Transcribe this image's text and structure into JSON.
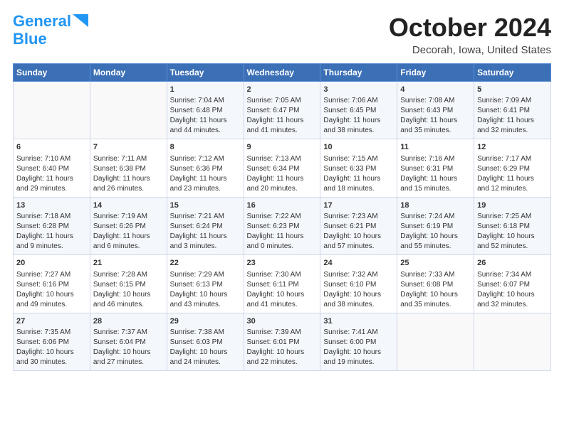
{
  "header": {
    "logo_line1": "General",
    "logo_line2": "Blue",
    "month_title": "October 2024",
    "location": "Decorah, Iowa, United States"
  },
  "weekdays": [
    "Sunday",
    "Monday",
    "Tuesday",
    "Wednesday",
    "Thursday",
    "Friday",
    "Saturday"
  ],
  "weeks": [
    [
      {
        "day": "",
        "info": ""
      },
      {
        "day": "",
        "info": ""
      },
      {
        "day": "1",
        "info": "Sunrise: 7:04 AM\nSunset: 6:48 PM\nDaylight: 11 hours and 44 minutes."
      },
      {
        "day": "2",
        "info": "Sunrise: 7:05 AM\nSunset: 6:47 PM\nDaylight: 11 hours and 41 minutes."
      },
      {
        "day": "3",
        "info": "Sunrise: 7:06 AM\nSunset: 6:45 PM\nDaylight: 11 hours and 38 minutes."
      },
      {
        "day": "4",
        "info": "Sunrise: 7:08 AM\nSunset: 6:43 PM\nDaylight: 11 hours and 35 minutes."
      },
      {
        "day": "5",
        "info": "Sunrise: 7:09 AM\nSunset: 6:41 PM\nDaylight: 11 hours and 32 minutes."
      }
    ],
    [
      {
        "day": "6",
        "info": "Sunrise: 7:10 AM\nSunset: 6:40 PM\nDaylight: 11 hours and 29 minutes."
      },
      {
        "day": "7",
        "info": "Sunrise: 7:11 AM\nSunset: 6:38 PM\nDaylight: 11 hours and 26 minutes."
      },
      {
        "day": "8",
        "info": "Sunrise: 7:12 AM\nSunset: 6:36 PM\nDaylight: 11 hours and 23 minutes."
      },
      {
        "day": "9",
        "info": "Sunrise: 7:13 AM\nSunset: 6:34 PM\nDaylight: 11 hours and 20 minutes."
      },
      {
        "day": "10",
        "info": "Sunrise: 7:15 AM\nSunset: 6:33 PM\nDaylight: 11 hours and 18 minutes."
      },
      {
        "day": "11",
        "info": "Sunrise: 7:16 AM\nSunset: 6:31 PM\nDaylight: 11 hours and 15 minutes."
      },
      {
        "day": "12",
        "info": "Sunrise: 7:17 AM\nSunset: 6:29 PM\nDaylight: 11 hours and 12 minutes."
      }
    ],
    [
      {
        "day": "13",
        "info": "Sunrise: 7:18 AM\nSunset: 6:28 PM\nDaylight: 11 hours and 9 minutes."
      },
      {
        "day": "14",
        "info": "Sunrise: 7:19 AM\nSunset: 6:26 PM\nDaylight: 11 hours and 6 minutes."
      },
      {
        "day": "15",
        "info": "Sunrise: 7:21 AM\nSunset: 6:24 PM\nDaylight: 11 hours and 3 minutes."
      },
      {
        "day": "16",
        "info": "Sunrise: 7:22 AM\nSunset: 6:23 PM\nDaylight: 11 hours and 0 minutes."
      },
      {
        "day": "17",
        "info": "Sunrise: 7:23 AM\nSunset: 6:21 PM\nDaylight: 10 hours and 57 minutes."
      },
      {
        "day": "18",
        "info": "Sunrise: 7:24 AM\nSunset: 6:19 PM\nDaylight: 10 hours and 55 minutes."
      },
      {
        "day": "19",
        "info": "Sunrise: 7:25 AM\nSunset: 6:18 PM\nDaylight: 10 hours and 52 minutes."
      }
    ],
    [
      {
        "day": "20",
        "info": "Sunrise: 7:27 AM\nSunset: 6:16 PM\nDaylight: 10 hours and 49 minutes."
      },
      {
        "day": "21",
        "info": "Sunrise: 7:28 AM\nSunset: 6:15 PM\nDaylight: 10 hours and 46 minutes."
      },
      {
        "day": "22",
        "info": "Sunrise: 7:29 AM\nSunset: 6:13 PM\nDaylight: 10 hours and 43 minutes."
      },
      {
        "day": "23",
        "info": "Sunrise: 7:30 AM\nSunset: 6:11 PM\nDaylight: 10 hours and 41 minutes."
      },
      {
        "day": "24",
        "info": "Sunrise: 7:32 AM\nSunset: 6:10 PM\nDaylight: 10 hours and 38 minutes."
      },
      {
        "day": "25",
        "info": "Sunrise: 7:33 AM\nSunset: 6:08 PM\nDaylight: 10 hours and 35 minutes."
      },
      {
        "day": "26",
        "info": "Sunrise: 7:34 AM\nSunset: 6:07 PM\nDaylight: 10 hours and 32 minutes."
      }
    ],
    [
      {
        "day": "27",
        "info": "Sunrise: 7:35 AM\nSunset: 6:06 PM\nDaylight: 10 hours and 30 minutes."
      },
      {
        "day": "28",
        "info": "Sunrise: 7:37 AM\nSunset: 6:04 PM\nDaylight: 10 hours and 27 minutes."
      },
      {
        "day": "29",
        "info": "Sunrise: 7:38 AM\nSunset: 6:03 PM\nDaylight: 10 hours and 24 minutes."
      },
      {
        "day": "30",
        "info": "Sunrise: 7:39 AM\nSunset: 6:01 PM\nDaylight: 10 hours and 22 minutes."
      },
      {
        "day": "31",
        "info": "Sunrise: 7:41 AM\nSunset: 6:00 PM\nDaylight: 10 hours and 19 minutes."
      },
      {
        "day": "",
        "info": ""
      },
      {
        "day": "",
        "info": ""
      }
    ]
  ]
}
